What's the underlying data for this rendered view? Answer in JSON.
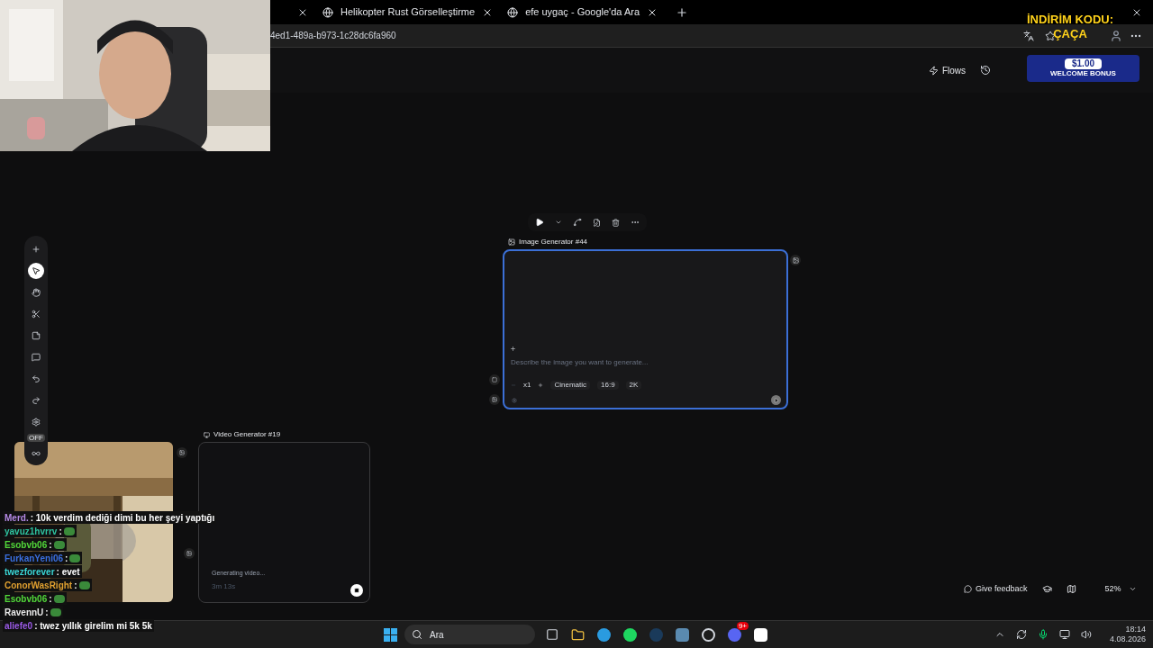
{
  "browser": {
    "tabs": [
      {
        "title": "Helikopter Rust Görselleştirme",
        "selected": false
      },
      {
        "title": "efe uygaç - Google'da Ara",
        "selected": false
      }
    ],
    "address": "4ed1-489a-b973-1c28dc6fa960"
  },
  "header": {
    "flows": "Flows"
  },
  "left_toolbar": [
    {
      "kind": "add",
      "selected": false
    },
    {
      "kind": "select",
      "selected": true
    },
    {
      "kind": "hand",
      "selected": false
    },
    {
      "kind": "cut",
      "selected": false
    },
    {
      "kind": "note",
      "selected": false
    },
    {
      "kind": "comment",
      "selected": false
    },
    {
      "kind": "undo",
      "selected": false
    },
    {
      "kind": "redo",
      "selected": false
    },
    {
      "kind": "settings",
      "selected": false
    },
    {
      "kind": "loop",
      "selected": false,
      "badge": "OFF"
    }
  ],
  "image_node": {
    "title": "Image Generator #44",
    "selected": true,
    "placeholder": "Describe the image you want to generate...",
    "count": "x1",
    "style": "Cinematic",
    "ratio": "16:9",
    "resolution": "2K"
  },
  "video_node": {
    "title": "Video Generator #19",
    "selected": false,
    "status": "Generating video...",
    "elapsed": "3m 13s"
  },
  "footer": {
    "feedback": "Give feedback",
    "zoom": "52%"
  },
  "promo": {
    "code_label": "İNDİRİM KODU:",
    "code": "ÇAÇA",
    "amount": "$1.00",
    "bonus": "WELCOME BONUS"
  },
  "chat": [
    {
      "user": "Merd.",
      "color": "#b58ae6",
      "text": ": 10k verdim dediği dimi bu her şeyi yaptığı",
      "emote": false
    },
    {
      "user": "yavuz1hvrrv",
      "color": "#2ec4a0",
      "text": ":",
      "emote": true
    },
    {
      "user": "Esobvb06",
      "color": "#52d83a",
      "text": ":",
      "emote": true
    },
    {
      "user": "FurkanYeni06",
      "color": "#3a6fe0",
      "text": ":",
      "emote": true
    },
    {
      "user": "twezforever",
      "color": "#3ad6d6",
      "text": ": evet",
      "emote": false
    },
    {
      "user": "ConorWasRight",
      "color": "#e0a030",
      "text": ":",
      "emote": true
    },
    {
      "user": "Esobvb06",
      "color": "#52d83a",
      "text": ":",
      "emote": true
    },
    {
      "user": "RavennU",
      "color": "#e8e8e8",
      "text": ":",
      "emote": true
    },
    {
      "user": "aliefe0",
      "color": "#9a5ae6",
      "text": ": twez yıllık girelim mi 5k 5k",
      "emote": false
    }
  ],
  "taskbar": {
    "search": "Ara",
    "time": "18:14",
    "date": "4.08.2026",
    "discord_badge": "9+"
  }
}
